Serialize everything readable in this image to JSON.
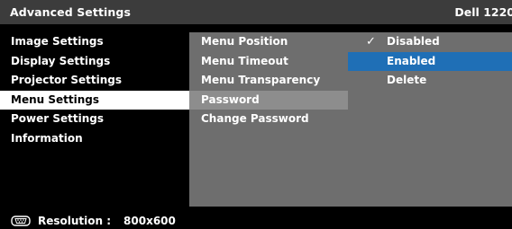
{
  "header": {
    "title": "Advanced Settings",
    "model": "Dell 1220"
  },
  "main_menu": [
    {
      "label": "Image Settings"
    },
    {
      "label": "Display Settings"
    },
    {
      "label": "Projector Settings"
    },
    {
      "label": "Menu Settings",
      "selected": true
    },
    {
      "label": "Power Settings"
    },
    {
      "label": "Information"
    }
  ],
  "submenu": [
    {
      "label": "Menu Position"
    },
    {
      "label": "Menu Timeout"
    },
    {
      "label": "Menu Transparency"
    },
    {
      "label": "Password",
      "highlighted": true
    },
    {
      "label": "Change Password"
    }
  ],
  "options": [
    {
      "label": "Disabled",
      "checked": true
    },
    {
      "label": "Enabled",
      "active": true
    },
    {
      "label": "Delete"
    }
  ],
  "footer": {
    "icon": "vga-connector-icon",
    "resolution_label": "Resolution :",
    "resolution_value": "800x600"
  },
  "colors": {
    "top_bar": "#3c3c3c",
    "panel": "#6e6e6e",
    "selected_bg": "#ffffff",
    "active_option": "#1f6fb6"
  },
  "check_glyph": "✓"
}
